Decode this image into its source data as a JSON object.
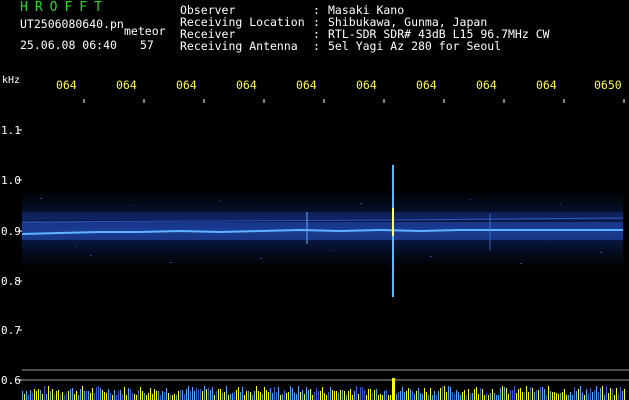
{
  "header": {
    "title": "HROFFT",
    "filename": "UT2506080640.pn",
    "meteor_label": "meteor",
    "date_time": "25.06.08 06:40",
    "count": "57",
    "fields": [
      {
        "label": "Observer",
        "colon": ":",
        "value": "Masaki Kano"
      },
      {
        "label": "Receiving Location",
        "colon": ":",
        "value": "Shibukawa, Gunma, Japan"
      },
      {
        "label": "Receiver",
        "colon": ":",
        "value": "RTL-SDR SDR# 43dB L15 96.7MHz CW"
      },
      {
        "label": "Receiving Antenna",
        "colon": ":",
        "value": "5el Yagi Az 280 for Seoul"
      }
    ]
  },
  "axis": {
    "unit": "kHz",
    "time_ticks": [
      "064",
      "064",
      "064",
      "064",
      "064",
      "064",
      "064",
      "064",
      "064",
      "0650"
    ],
    "freq_ticks": [
      "1.1",
      "1.0",
      "0.9",
      "0.8",
      "0.7",
      "0.6"
    ]
  },
  "colors": {
    "title": "#22dd22",
    "header_text": "#ffffff",
    "tick_text": "#ffff33",
    "signal": "#3c8cff",
    "bar": "#ffff00"
  }
}
